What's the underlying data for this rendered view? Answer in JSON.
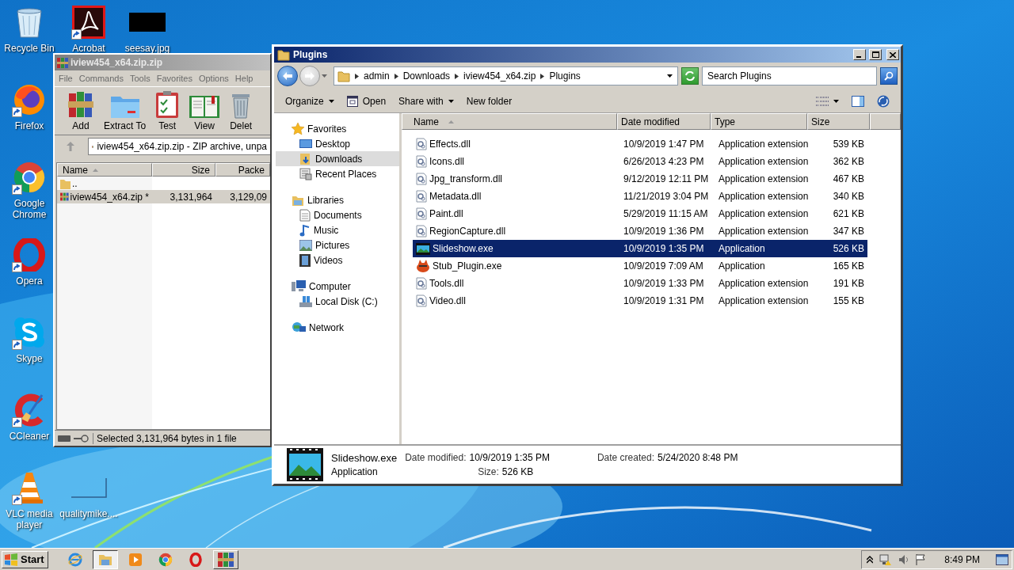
{
  "desktop": {
    "icons": [
      {
        "kind": "recycle-bin",
        "label": "Recycle Bin",
        "shortcut": false
      },
      {
        "kind": "acrobat",
        "label": "Acrobat",
        "shortcut": true
      },
      {
        "kind": "thumbnail",
        "label": "seesay.jpg",
        "shortcut": false
      },
      {
        "kind": "firefox",
        "label": "Firefox",
        "shortcut": true
      },
      {
        "kind": "chrome",
        "label": "Google Chrome",
        "shortcut": true
      },
      {
        "kind": "opera",
        "label": "Opera",
        "shortcut": true
      },
      {
        "kind": "skype",
        "label": "Skype",
        "shortcut": true
      },
      {
        "kind": "ccleaner",
        "label": "CCleaner",
        "shortcut": true
      },
      {
        "kind": "vlc",
        "label": "VLC media player",
        "shortcut": true
      },
      {
        "kind": "blank",
        "label": "qualitymike....",
        "shortcut": false
      }
    ]
  },
  "archive_window": {
    "title": "iview454_x64.zip.zip",
    "menu": [
      "File",
      "Commands",
      "Tools",
      "Favorites",
      "Options",
      "Help"
    ],
    "toolbar": [
      {
        "kind": "add",
        "label": "Add"
      },
      {
        "kind": "extract",
        "label": "Extract To"
      },
      {
        "kind": "test",
        "label": "Test"
      },
      {
        "kind": "view",
        "label": "View"
      },
      {
        "kind": "delete",
        "label": "Delet"
      }
    ],
    "address": "iview454_x64.zip.zip - ZIP archive, unpa",
    "columns": [
      {
        "label": "Name",
        "sorted": true
      },
      {
        "label": "Size",
        "sorted": false
      },
      {
        "label": "Packe",
        "sorted": false
      }
    ],
    "rows": [
      {
        "kind": "folder",
        "cells": [
          ".."
        ],
        "selected": false
      },
      {
        "kind": "archive",
        "cells": [
          "iview454_x64.zip *",
          "3,131,964",
          "3,129,09"
        ],
        "selected": true
      }
    ],
    "status": "Selected 3,131,964 bytes in 1 file"
  },
  "explorer": {
    "title": "Plugins",
    "breadcrumb": [
      "admin",
      "Downloads",
      "iview454_x64.zip",
      "Plugins"
    ],
    "search": {
      "placeholder": "Search Plugins"
    },
    "commands": [
      {
        "kind": "plain",
        "label": "Organize",
        "dropdown": true
      },
      {
        "kind": "open",
        "label": "Open",
        "dropdown": false
      },
      {
        "kind": "plain",
        "label": "Share with",
        "dropdown": true
      },
      {
        "kind": "plain",
        "label": "New folder",
        "dropdown": false
      }
    ],
    "nav": [
      {
        "kind": "favorites",
        "label": "Favorites",
        "selected": false,
        "children": [
          {
            "kind": "desktop",
            "label": "Desktop",
            "selected": false
          },
          {
            "kind": "downloads",
            "label": "Downloads",
            "selected": true
          },
          {
            "kind": "recent",
            "label": "Recent Places",
            "selected": false
          }
        ]
      },
      {
        "kind": "libraries",
        "label": "Libraries",
        "selected": false,
        "children": [
          {
            "kind": "documents",
            "label": "Documents",
            "selected": false
          },
          {
            "kind": "music",
            "label": "Music",
            "selected": false
          },
          {
            "kind": "pictures",
            "label": "Pictures",
            "selected": false
          },
          {
            "kind": "videos",
            "label": "Videos",
            "selected": false
          }
        ]
      },
      {
        "kind": "computer",
        "label": "Computer",
        "selected": false,
        "children": [
          {
            "kind": "disk",
            "label": "Local Disk (C:)",
            "selected": false
          }
        ]
      },
      {
        "kind": "network",
        "label": "Network",
        "selected": false
      }
    ],
    "columns": [
      {
        "label": "Name",
        "sorted": true
      },
      {
        "label": "Date modified",
        "sorted": false
      },
      {
        "label": "Type",
        "sorted": false
      },
      {
        "label": "Size",
        "sorted": false
      }
    ],
    "files": [
      {
        "kind": "dll",
        "name": "Effects.dll",
        "date": "10/9/2019 1:47 PM",
        "type": "Application extension",
        "size": "539 KB",
        "selected": false
      },
      {
        "kind": "dll",
        "name": "Icons.dll",
        "date": "6/26/2013 4:23 PM",
        "type": "Application extension",
        "size": "362 KB",
        "selected": false
      },
      {
        "kind": "dll",
        "name": "Jpg_transform.dll",
        "date": "9/12/2019 12:11 PM",
        "type": "Application extension",
        "size": "467 KB",
        "selected": false
      },
      {
        "kind": "dll",
        "name": "Metadata.dll",
        "date": "11/21/2019 3:04 PM",
        "type": "Application extension",
        "size": "340 KB",
        "selected": false
      },
      {
        "kind": "dll",
        "name": "Paint.dll",
        "date": "5/29/2019 11:15 AM",
        "type": "Application extension",
        "size": "621 KB",
        "selected": false
      },
      {
        "kind": "dll",
        "name": "RegionCapture.dll",
        "date": "10/9/2019 1:36 PM",
        "type": "Application extension",
        "size": "347 KB",
        "selected": false
      },
      {
        "kind": "slideshow",
        "name": "Slideshow.exe",
        "date": "10/9/2019 1:35 PM",
        "type": "Application",
        "size": "526 KB",
        "selected": true
      },
      {
        "kind": "stub",
        "name": "Stub_Plugin.exe",
        "date": "10/9/2019 7:09 AM",
        "type": "Application",
        "size": "165 KB",
        "selected": false
      },
      {
        "kind": "dll",
        "name": "Tools.dll",
        "date": "10/9/2019 1:33 PM",
        "type": "Application extension",
        "size": "191 KB",
        "selected": false
      },
      {
        "kind": "dll",
        "name": "Video.dll",
        "date": "10/9/2019 1:31 PM",
        "type": "Application extension",
        "size": "155 KB",
        "selected": false
      }
    ],
    "details": {
      "name": "Slideshow.exe",
      "type": "Application",
      "fields": [
        {
          "label": "Date modified:",
          "value": "10/9/2019 1:35 PM"
        },
        {
          "label": "Date created:",
          "value": "5/24/2020 8:48 PM"
        },
        {
          "label": "Size:",
          "value": "526 KB"
        }
      ]
    }
  },
  "taskbar": {
    "start": "Start",
    "apps": [
      {
        "kind": "ie",
        "selected": false,
        "running": false
      },
      {
        "kind": "explorer",
        "selected": true,
        "running": true
      },
      {
        "kind": "media-player",
        "selected": false,
        "running": false
      },
      {
        "kind": "chrome",
        "selected": false,
        "running": false
      },
      {
        "kind": "opera",
        "selected": false,
        "running": false
      },
      {
        "kind": "winrar",
        "selected": false,
        "running": true
      }
    ],
    "clock": "8:49 PM"
  }
}
